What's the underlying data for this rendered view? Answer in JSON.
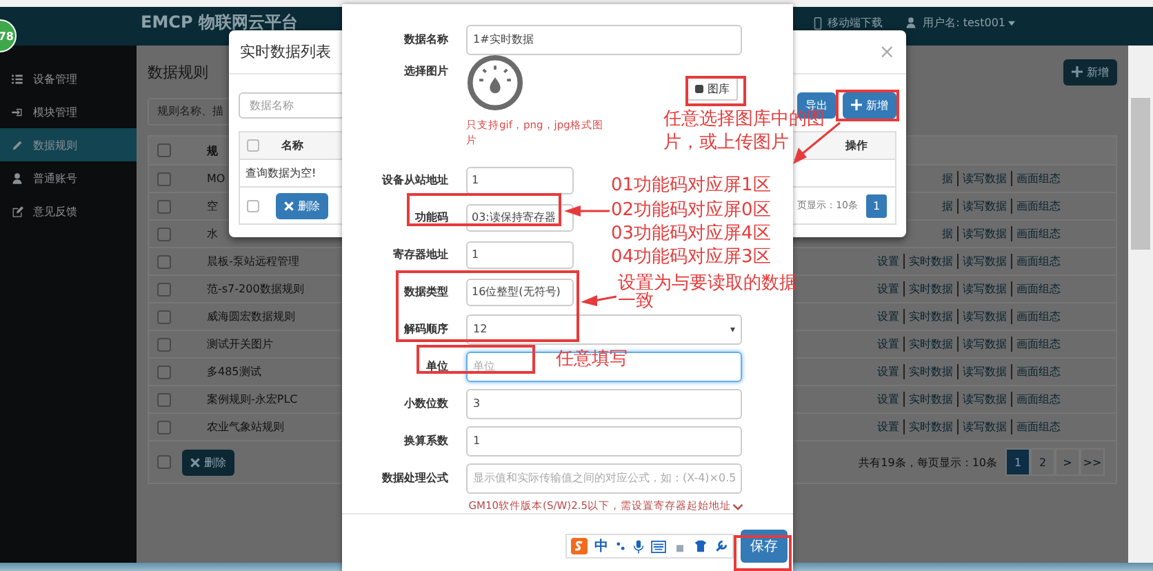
{
  "badge": "78",
  "header": {
    "logo": "EMCP 物联网云平台",
    "mobile_download": "移动端下载",
    "user": "用户名: test001"
  },
  "sidebar": {
    "items": [
      {
        "label": "设备管理",
        "selected": false
      },
      {
        "label": "模块管理",
        "selected": false
      },
      {
        "label": "数据规则",
        "selected": true
      },
      {
        "label": "普通账号",
        "selected": false
      },
      {
        "label": "意见反馈",
        "selected": false
      }
    ]
  },
  "main": {
    "title": "数据规则",
    "add_button": "新增",
    "search": {
      "placeholder": "规则名称、描"
    },
    "table": {
      "columns": [
        "规"
      ],
      "header_checked": false,
      "rows": [
        {
          "checked": false,
          "name": "MO",
          "actions": [
            "据",
            "读写数据",
            "画面组态"
          ]
        },
        {
          "checked": false,
          "name": "空",
          "actions": [
            "据",
            "读写数据",
            "画面组态"
          ]
        },
        {
          "checked": false,
          "name": "水",
          "actions": [
            "据",
            "读写数据",
            "画面组态"
          ]
        },
        {
          "checked": false,
          "name": "晨板-泵站远程管理",
          "actions": [
            "设置",
            "实时数据",
            "读写数据",
            "画面组态"
          ]
        },
        {
          "checked": false,
          "name": "范-s7-200数据规则",
          "actions": [
            "设置",
            "实时数据",
            "读写数据",
            "画面组态"
          ]
        },
        {
          "checked": false,
          "name": "威海圆宏数据规则",
          "actions": [
            "设置",
            "实时数据",
            "读写数据",
            "画面组态"
          ]
        },
        {
          "checked": false,
          "name": "测试开关图片",
          "actions": [
            "设置",
            "实时数据",
            "读写数据",
            "画面组态"
          ]
        },
        {
          "checked": false,
          "name": "多485测试",
          "actions": [
            "设置",
            "实时数据",
            "读写数据",
            "画面组态"
          ]
        },
        {
          "checked": false,
          "name": "案例规则-永宏PLC",
          "actions": [
            "设置",
            "实时数据",
            "读写数据",
            "画面组态"
          ]
        },
        {
          "checked": false,
          "name": "农业气象站规则",
          "actions": [
            "设置",
            "实时数据",
            "读写数据",
            "画面组态"
          ]
        }
      ],
      "footer_checked": false
    },
    "delete_button": "删除",
    "summary": "共有19条，每页显示：10条",
    "pages": [
      {
        "label": "1",
        "selected": true
      },
      {
        "label": "2",
        "selected": false
      },
      {
        "label": ">",
        "selected": false
      },
      {
        "label": ">>",
        "selected": false
      }
    ]
  },
  "list_dialog": {
    "title": "实时数据列表",
    "close": "×",
    "search": {
      "placeholder": "数据名称"
    },
    "export_button": "导出",
    "add_button": "新增",
    "header_checked": false,
    "columns": [
      "名称",
      "操作"
    ],
    "empty_message": "查询数据为空!",
    "footer_checked": false,
    "delete_button": "删除",
    "page_info": "页显示：10条",
    "pages": [
      {
        "label": "1",
        "selected": true
      }
    ]
  },
  "form_dialog": {
    "fields": [
      {
        "kind": "input",
        "label": "数据名称",
        "value": "1#实时数据",
        "focused": false
      },
      {
        "kind": "image",
        "label": "选择图片",
        "button": "图库",
        "hint": "只支持gif，png，jpg格式图片"
      },
      {
        "kind": "input",
        "label": "设备从站地址",
        "value": "1",
        "focused": false
      },
      {
        "kind": "select",
        "label": "功能码",
        "value": "03:读保持寄存器",
        "focused": false
      },
      {
        "kind": "input",
        "label": "寄存器地址",
        "value": "1",
        "focused": false
      },
      {
        "kind": "select",
        "label": "数据类型",
        "value": "16位整型(无符号)",
        "focused": false
      },
      {
        "kind": "select",
        "label": "解码顺序",
        "value": "12",
        "caret": "▾",
        "focused": false
      },
      {
        "kind": "input",
        "label": "单位",
        "placeholder": "单位",
        "focused": true
      },
      {
        "kind": "input",
        "label": "小数位数",
        "value": "3",
        "focused": false
      },
      {
        "kind": "input",
        "label": "换算系数",
        "value": "1",
        "focused": false
      },
      {
        "kind": "input",
        "label": "数据处理公式",
        "placeholder": "显示值和实际传输值之间的对应公式，如：(X-4)×0.5",
        "focused": false
      }
    ],
    "note": "GM10软件版本(S/W)2.5以下，需设置寄存器起始地址",
    "save_button": "保存",
    "ime": "中"
  },
  "annotations": [
    {
      "kind": "note",
      "text": "任意选择图库中的图片，或上传图片"
    },
    {
      "kind": "note",
      "text": "01功能码对应屏1区"
    },
    {
      "kind": "note",
      "text": "02功能码对应屏0区"
    },
    {
      "kind": "note",
      "text": "03功能码对应屏4区"
    },
    {
      "kind": "note",
      "text": "04功能码对应屏3区"
    },
    {
      "kind": "note",
      "text": "设置为与要读取的数据一致"
    },
    {
      "kind": "note",
      "text": "任意填写"
    }
  ]
}
